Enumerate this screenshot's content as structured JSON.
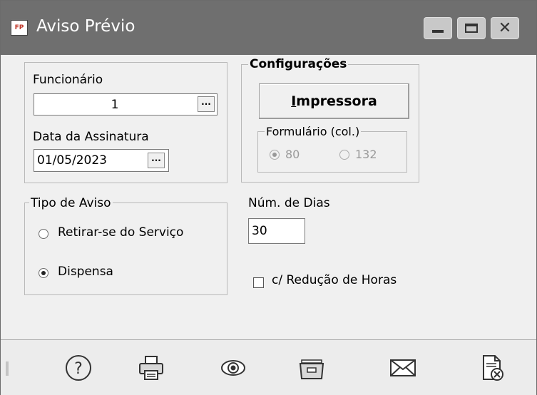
{
  "window": {
    "title": "Aviso Prévio",
    "app_icon": "FP"
  },
  "funcionario": {
    "label": "Funcionário",
    "value": "1",
    "lookup": "···"
  },
  "data_assinatura": {
    "label": "Data da Assinatura",
    "value": "01/05/2023",
    "lookup": "···"
  },
  "configuracoes": {
    "title": "Configurações",
    "button_accel": "I",
    "button_rest": "mpressora",
    "formulario": {
      "label": "Formulário (col.)",
      "opt1": "80",
      "opt2": "132",
      "selected": "80"
    }
  },
  "tipo_aviso": {
    "label": "Tipo de Aviso",
    "opt1": "Retirar-se do Serviço",
    "opt2": "Dispensa",
    "selected": "Dispensa"
  },
  "num_dias": {
    "label": "Núm. de Dias",
    "value": "30"
  },
  "reducao": {
    "label": "c/ Redução de Horas",
    "checked": false
  },
  "footer": {
    "icons": [
      "help-icon",
      "printer-icon",
      "preview-eye-icon",
      "folder-icon",
      "mail-icon",
      "document-close-icon"
    ]
  }
}
